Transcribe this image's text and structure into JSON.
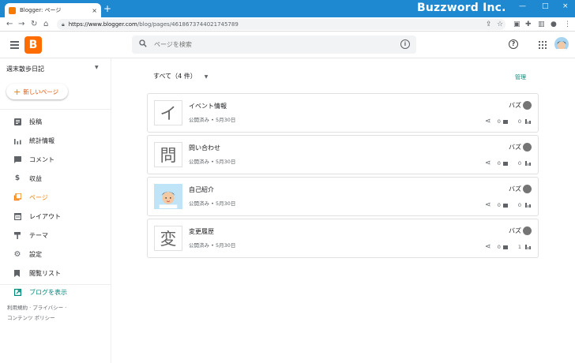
{
  "browser": {
    "tab_title": "Blogger: ページ",
    "tab_close": "×",
    "new_tab": "+",
    "url_host": "https://www.blogger.com",
    "url_path": "/blog/pages/4618673744021745789",
    "watermark": "Buzzword Inc.",
    "win_min": "—",
    "win_max": "□",
    "win_close": "×"
  },
  "header": {
    "search_placeholder": "ページを検索",
    "help_glyph": "?",
    "info_glyph": "i",
    "brand_color": "#ff6d00"
  },
  "sidebar": {
    "blog_name": "週末散歩日記",
    "new_button": "新しいページ",
    "items": [
      {
        "label": "投稿",
        "icon": "post-icon"
      },
      {
        "label": "統計情報",
        "icon": "stats-icon"
      },
      {
        "label": "コメント",
        "icon": "comment-icon"
      },
      {
        "label": "収益",
        "icon": "dollar-icon"
      },
      {
        "label": "ページ",
        "icon": "pages-icon",
        "active": true
      },
      {
        "label": "レイアウト",
        "icon": "layout-icon"
      },
      {
        "label": "テーマ",
        "icon": "theme-icon"
      },
      {
        "label": "設定",
        "icon": "gear-icon"
      },
      {
        "label": "閲覧リスト",
        "icon": "bookmark-icon"
      }
    ],
    "view_blog": "ブログを表示",
    "footer_line1": "利用規約 · プライバシー ·",
    "footer_line2": "コンテンツ ポリシー"
  },
  "main": {
    "filter": "すべて（4 件）",
    "manage": "管理",
    "pages": [
      {
        "title": "イベント情報",
        "meta": "公開済み • 5月30日",
        "thumb": "イ",
        "author": "バズ",
        "comments": "0",
        "views": "0"
      },
      {
        "title": "問い合わせ",
        "meta": "公開済み • 5月30日",
        "thumb": "問",
        "author": "バズ",
        "comments": "0",
        "views": "0"
      },
      {
        "title": "自己紹介",
        "meta": "公開済み • 5月30日",
        "thumb": "",
        "author": "バズ",
        "comments": "0",
        "views": "0"
      },
      {
        "title": "変更履歴",
        "meta": "公開済み • 5月30日",
        "thumb": "変",
        "author": "バズ",
        "comments": "0",
        "views": "1"
      }
    ]
  },
  "colors": {
    "accent": "#f57c00",
    "teal": "#00897b",
    "titlebar": "#1e88d0"
  }
}
